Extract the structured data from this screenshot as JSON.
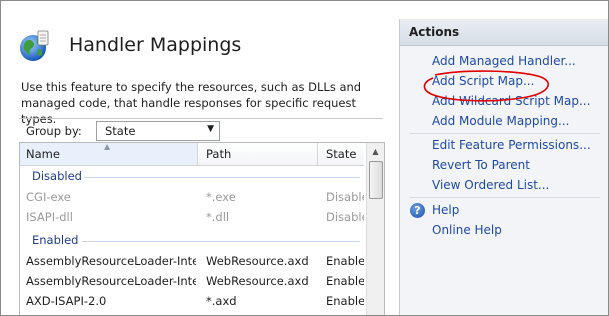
{
  "page": {
    "title": "Handler Mappings",
    "description": "Use this feature to specify the resources, such as DLLs and managed code, that handle responses for specific request types."
  },
  "toolbar": {
    "group_by_label": "Group by:",
    "group_by_value": "State"
  },
  "grid": {
    "columns": [
      "Name",
      "Path",
      "State"
    ],
    "groups": [
      {
        "label": "Disabled",
        "rows": [
          {
            "name": "CGI-exe",
            "path": "*.exe",
            "state": "Disabled"
          },
          {
            "name": "ISAPI-dll",
            "path": "*.dll",
            "state": "Disabled"
          }
        ]
      },
      {
        "label": "Enabled",
        "rows": [
          {
            "name": "AssemblyResourceLoader-Inte...",
            "path": "WebResource.axd",
            "state": "Enabled"
          },
          {
            "name": "AssemblyResourceLoader-Inte...",
            "path": "WebResource.axd",
            "state": "Enabled"
          },
          {
            "name": "AXD-ISAPI-2.0",
            "path": "*.axd",
            "state": "Enabled"
          }
        ]
      }
    ]
  },
  "actions": {
    "header": "Actions",
    "items": [
      "Add Managed Handler...",
      "Add Script Map...",
      "Add Wildcard Script Map...",
      "Add Module Mapping...",
      "Edit Feature Permissions...",
      "Revert To Parent",
      "View Ordered List..."
    ],
    "help": [
      "Help",
      "Online Help"
    ]
  },
  "colors": {
    "link": "#1f4aa3",
    "group_label": "#1f3c88",
    "annotation": "#e00000",
    "disabled_text": "#9a9a9a"
  },
  "icons": {
    "feature": "globe-icon",
    "help": "help-icon",
    "sort": "sort-ascending-icon",
    "dropdown": "chevron-down-icon"
  }
}
